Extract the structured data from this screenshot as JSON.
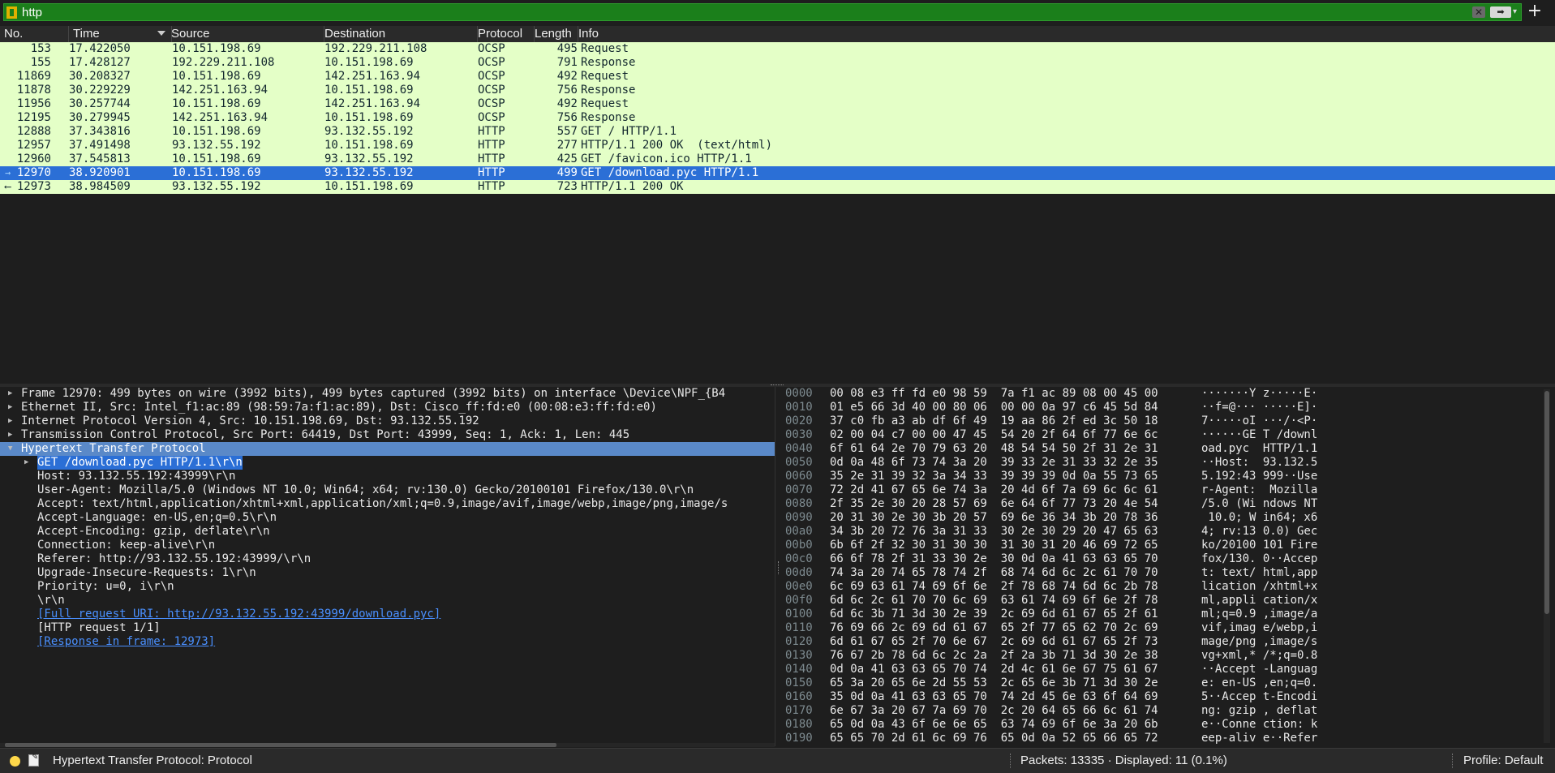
{
  "filter": {
    "value": "http"
  },
  "columns": [
    "No.",
    "Time",
    "Source",
    "Destination",
    "Protocol",
    "Length",
    "Info"
  ],
  "packets": [
    {
      "no": "153",
      "time": "17.422050",
      "src": "10.151.198.69",
      "dst": "192.229.211.108",
      "proto": "OCSP",
      "len": "495",
      "info": "Request"
    },
    {
      "no": "155",
      "time": "17.428127",
      "src": "192.229.211.108",
      "dst": "10.151.198.69",
      "proto": "OCSP",
      "len": "791",
      "info": "Response"
    },
    {
      "no": "11869",
      "time": "30.208327",
      "src": "10.151.198.69",
      "dst": "142.251.163.94",
      "proto": "OCSP",
      "len": "492",
      "info": "Request"
    },
    {
      "no": "11878",
      "time": "30.229229",
      "src": "142.251.163.94",
      "dst": "10.151.198.69",
      "proto": "OCSP",
      "len": "756",
      "info": "Response"
    },
    {
      "no": "11956",
      "time": "30.257744",
      "src": "10.151.198.69",
      "dst": "142.251.163.94",
      "proto": "OCSP",
      "len": "492",
      "info": "Request"
    },
    {
      "no": "12195",
      "time": "30.279945",
      "src": "142.251.163.94",
      "dst": "10.151.198.69",
      "proto": "OCSP",
      "len": "756",
      "info": "Response"
    },
    {
      "no": "12888",
      "time": "37.343816",
      "src": "10.151.198.69",
      "dst": "93.132.55.192",
      "proto": "HTTP",
      "len": "557",
      "info": "GET / HTTP/1.1"
    },
    {
      "no": "12957",
      "time": "37.491498",
      "src": "93.132.55.192",
      "dst": "10.151.198.69",
      "proto": "HTTP",
      "len": "277",
      "info": "HTTP/1.1 200 OK  (text/html)"
    },
    {
      "no": "12960",
      "time": "37.545813",
      "src": "10.151.198.69",
      "dst": "93.132.55.192",
      "proto": "HTTP",
      "len": "425",
      "info": "GET /favicon.ico HTTP/1.1"
    },
    {
      "no": "12970",
      "time": "38.920901",
      "src": "10.151.198.69",
      "dst": "93.132.55.192",
      "proto": "HTTP",
      "len": "499",
      "info": "GET /download.pyc HTTP/1.1",
      "selected": true
    },
    {
      "no": "12973",
      "time": "38.984509",
      "src": "93.132.55.192",
      "dst": "10.151.198.69",
      "proto": "HTTP",
      "len": "723",
      "info": "HTTP/1.1 200 OK"
    }
  ],
  "detail": [
    {
      "level": 1,
      "expand": "closed",
      "text": "Frame 12970: 499 bytes on wire (3992 bits), 499 bytes captured (3992 bits) on interface \\Device\\NPF_{B4"
    },
    {
      "level": 1,
      "expand": "closed",
      "text": "Ethernet II, Src: Intel_f1:ac:89 (98:59:7a:f1:ac:89), Dst: Cisco_ff:fd:e0 (00:08:e3:ff:fd:e0)"
    },
    {
      "level": 1,
      "expand": "closed",
      "text": "Internet Protocol Version 4, Src: 10.151.198.69, Dst: 93.132.55.192"
    },
    {
      "level": 1,
      "expand": "closed",
      "text": "Transmission Control Protocol, Src Port: 64419, Dst Port: 43999, Seq: 1, Ack: 1, Len: 445"
    },
    {
      "level": 1,
      "expand": "open",
      "text": "Hypertext Transfer Protocol",
      "highlight": "row"
    },
    {
      "level": 2,
      "expand": "closed",
      "text": "GET /download.pyc HTTP/1.1\\r\\n",
      "highlight": "text"
    },
    {
      "level": 2,
      "expand": "",
      "text": "Host: 93.132.55.192:43999\\r\\n"
    },
    {
      "level": 2,
      "expand": "",
      "text": "User-Agent: Mozilla/5.0 (Windows NT 10.0; Win64; x64; rv:130.0) Gecko/20100101 Firefox/130.0\\r\\n"
    },
    {
      "level": 2,
      "expand": "",
      "text": "Accept: text/html,application/xhtml+xml,application/xml;q=0.9,image/avif,image/webp,image/png,image/s"
    },
    {
      "level": 2,
      "expand": "",
      "text": "Accept-Language: en-US,en;q=0.5\\r\\n"
    },
    {
      "level": 2,
      "expand": "",
      "text": "Accept-Encoding: gzip, deflate\\r\\n"
    },
    {
      "level": 2,
      "expand": "",
      "text": "Connection: keep-alive\\r\\n"
    },
    {
      "level": 2,
      "expand": "",
      "text": "Referer: http://93.132.55.192:43999/\\r\\n"
    },
    {
      "level": 2,
      "expand": "",
      "text": "Upgrade-Insecure-Requests: 1\\r\\n"
    },
    {
      "level": 2,
      "expand": "",
      "text": "Priority: u=0, i\\r\\n"
    },
    {
      "level": 2,
      "expand": "",
      "text": "\\r\\n"
    },
    {
      "level": 2,
      "expand": "",
      "text": "[Full request URI: http://93.132.55.192:43999/download.pyc]",
      "link": true
    },
    {
      "level": 2,
      "expand": "",
      "text": "[HTTP request 1/1]"
    },
    {
      "level": 2,
      "expand": "",
      "text": "[Response in frame: 12973]",
      "link": true
    }
  ],
  "bytes": [
    {
      "off": "0000",
      "hex": "00 08 e3 ff fd e0 98 59  7a f1 ac 89 08 00 45 00",
      "ascii": "·······Y z·····E·"
    },
    {
      "off": "0010",
      "hex": "01 e5 66 3d 40 00 80 06  00 00 0a 97 c6 45 5d 84",
      "ascii": "··f=@··· ·····E]·"
    },
    {
      "off": "0020",
      "hex": "37 c0 fb a3 ab df 6f 49  19 aa 86 2f ed 3c 50 18",
      "ascii": "7·····oI ···/·<P·"
    },
    {
      "off": "0030",
      "hex": "02 00 04 c7 00 00 47 45  54 20 2f 64 6f 77 6e 6c",
      "ascii": "······GE T /downl"
    },
    {
      "off": "0040",
      "hex": "6f 61 64 2e 70 79 63 20  48 54 54 50 2f 31 2e 31",
      "ascii": "oad.pyc  HTTP/1.1"
    },
    {
      "off": "0050",
      "hex": "0d 0a 48 6f 73 74 3a 20  39 33 2e 31 33 32 2e 35",
      "ascii": "··Host:  93.132.5"
    },
    {
      "off": "0060",
      "hex": "35 2e 31 39 32 3a 34 33  39 39 39 0d 0a 55 73 65",
      "ascii": "5.192:43 999··Use"
    },
    {
      "off": "0070",
      "hex": "72 2d 41 67 65 6e 74 3a  20 4d 6f 7a 69 6c 6c 61",
      "ascii": "r-Agent:  Mozilla"
    },
    {
      "off": "0080",
      "hex": "2f 35 2e 30 20 28 57 69  6e 64 6f 77 73 20 4e 54",
      "ascii": "/5.0 (Wi ndows NT"
    },
    {
      "off": "0090",
      "hex": "20 31 30 2e 30 3b 20 57  69 6e 36 34 3b 20 78 36",
      "ascii": " 10.0; W in64; x6"
    },
    {
      "off": "00a0",
      "hex": "34 3b 20 72 76 3a 31 33  30 2e 30 29 20 47 65 63",
      "ascii": "4; rv:13 0.0) Gec"
    },
    {
      "off": "00b0",
      "hex": "6b 6f 2f 32 30 31 30 30  31 30 31 20 46 69 72 65",
      "ascii": "ko/20100 101 Fire"
    },
    {
      "off": "00c0",
      "hex": "66 6f 78 2f 31 33 30 2e  30 0d 0a 41 63 63 65 70",
      "ascii": "fox/130. 0··Accep"
    },
    {
      "off": "00d0",
      "hex": "74 3a 20 74 65 78 74 2f  68 74 6d 6c 2c 61 70 70",
      "ascii": "t: text/ html,app"
    },
    {
      "off": "00e0",
      "hex": "6c 69 63 61 74 69 6f 6e  2f 78 68 74 6d 6c 2b 78",
      "ascii": "lication /xhtml+x"
    },
    {
      "off": "00f0",
      "hex": "6d 6c 2c 61 70 70 6c 69  63 61 74 69 6f 6e 2f 78",
      "ascii": "ml,appli cation/x"
    },
    {
      "off": "0100",
      "hex": "6d 6c 3b 71 3d 30 2e 39  2c 69 6d 61 67 65 2f 61",
      "ascii": "ml;q=0.9 ,image/a"
    },
    {
      "off": "0110",
      "hex": "76 69 66 2c 69 6d 61 67  65 2f 77 65 62 70 2c 69",
      "ascii": "vif,imag e/webp,i"
    },
    {
      "off": "0120",
      "hex": "6d 61 67 65 2f 70 6e 67  2c 69 6d 61 67 65 2f 73",
      "ascii": "mage/png ,image/s"
    },
    {
      "off": "0130",
      "hex": "76 67 2b 78 6d 6c 2c 2a  2f 2a 3b 71 3d 30 2e 38",
      "ascii": "vg+xml,* /*;q=0.8"
    },
    {
      "off": "0140",
      "hex": "0d 0a 41 63 63 65 70 74  2d 4c 61 6e 67 75 61 67",
      "ascii": "··Accept -Languag"
    },
    {
      "off": "0150",
      "hex": "65 3a 20 65 6e 2d 55 53  2c 65 6e 3b 71 3d 30 2e",
      "ascii": "e: en-US ,en;q=0."
    },
    {
      "off": "0160",
      "hex": "35 0d 0a 41 63 63 65 70  74 2d 45 6e 63 6f 64 69",
      "ascii": "5··Accep t-Encodi"
    },
    {
      "off": "0170",
      "hex": "6e 67 3a 20 67 7a 69 70  2c 20 64 65 66 6c 61 74",
      "ascii": "ng: gzip , deflat"
    },
    {
      "off": "0180",
      "hex": "65 0d 0a 43 6f 6e 6e 65  63 74 69 6f 6e 3a 20 6b",
      "ascii": "e··Conne ction: k"
    },
    {
      "off": "0190",
      "hex": "65 65 70 2d 61 6c 69 76  65 0d 0a 52 65 66 65 72",
      "ascii": "eep-aliv e··Refer"
    }
  ],
  "status": {
    "field": "Hypertext Transfer Protocol: Protocol",
    "packets": "Packets: 13335 · Displayed: 11 (0.1%)",
    "profile": "Profile: Default"
  },
  "colors": {
    "filter_valid_bg": "#1b7f1b",
    "row_bg": "#e4ffc7",
    "selected_bg": "#2b6fd6",
    "link": "#4a90ff"
  },
  "icons": {
    "bookmark": "bookmark-icon",
    "clear": "clear-filter-icon",
    "apply": "apply-filter-arrow-icon",
    "add": "add-filter-button-icon",
    "expert": "expert-info-icon",
    "comment": "capture-comment-icon"
  }
}
